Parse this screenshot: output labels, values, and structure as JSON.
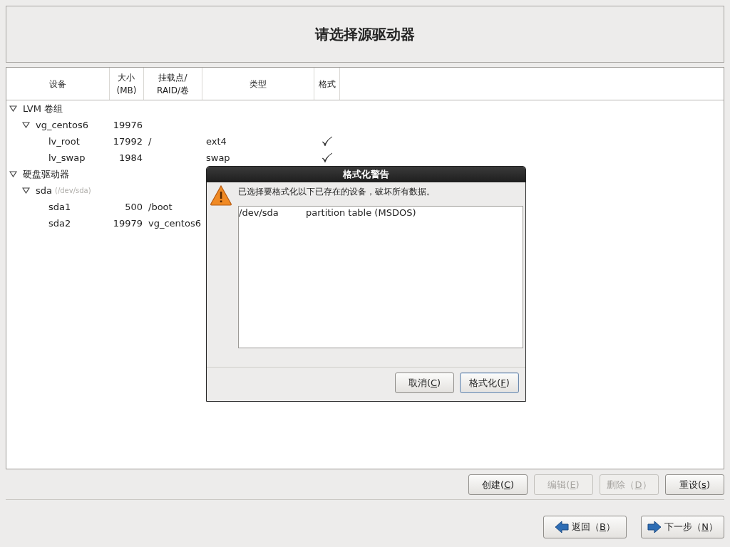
{
  "header": {
    "title": "请选择源驱动器"
  },
  "table": {
    "columns": [
      {
        "label": "设备"
      },
      {
        "label": "大小\n(MB)"
      },
      {
        "label": "挂载点/\nRAID/卷"
      },
      {
        "label": "类型"
      },
      {
        "label": "格式"
      }
    ],
    "rows": [
      {
        "device": "LVM 卷组",
        "expanded": true,
        "children": [
          {
            "device": "vg_centos6",
            "size": "19976",
            "expanded": true,
            "children": [
              {
                "device": "lv_root",
                "size": "17992",
                "mount": "/",
                "type": "ext4",
                "format": true
              },
              {
                "device": "lv_swap",
                "size": "1984",
                "type": "swap",
                "format": true
              }
            ]
          }
        ]
      },
      {
        "device": "硬盘驱动器",
        "expanded": true,
        "children": [
          {
            "device": "sda",
            "detail": "(/dev/sda)",
            "expanded": true,
            "children": [
              {
                "device": "sda1",
                "size": "500",
                "mount": "/boot"
              },
              {
                "device": "sda2",
                "size": "19979",
                "mount": "vg_centos6"
              }
            ]
          }
        ]
      }
    ]
  },
  "dialog": {
    "title": "格式化警告",
    "message": "已选择要格式化以下已存在的设备，破坏所有数据。",
    "items": [
      {
        "device": "/dev/sda",
        "description": "partition table (MSDOS)"
      }
    ],
    "buttons": [
      {
        "parts": [
          "取消(",
          "C",
          ")"
        ],
        "default": false
      },
      {
        "parts": [
          "格式化(",
          "F",
          ")"
        ],
        "default": true
      }
    ]
  },
  "actions": [
    {
      "parts": [
        "创建(",
        "C",
        ")"
      ],
      "disabled": false
    },
    {
      "parts": [
        "编辑(",
        "E",
        ")"
      ],
      "disabled": true
    },
    {
      "parts": [
        "删除（",
        "D",
        "）"
      ],
      "disabled": true
    },
    {
      "parts": [
        "重设(",
        "s",
        ")"
      ],
      "disabled": false
    }
  ],
  "navigation": [
    {
      "kind": "back",
      "parts": [
        "返回（",
        "B",
        "）"
      ]
    },
    {
      "kind": "next",
      "parts": [
        "下一步（",
        "N",
        "）"
      ]
    }
  ]
}
